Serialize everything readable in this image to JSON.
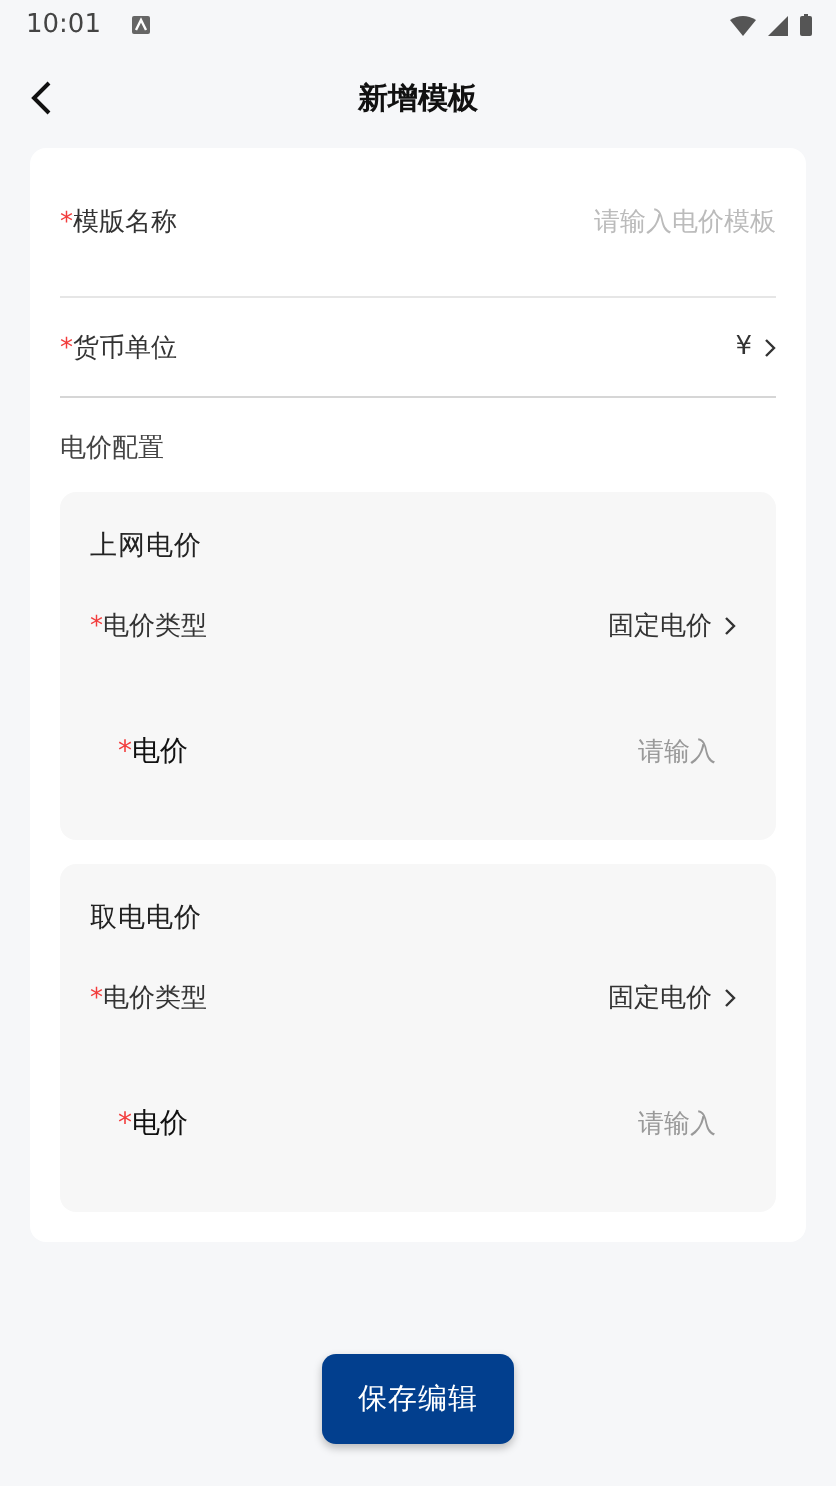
{
  "status_bar": {
    "time": "10:01"
  },
  "header": {
    "title": "新增模板"
  },
  "fields": [
    {
      "required_mark": "*",
      "label": "模版名称",
      "kind": "input",
      "placeholder": "请输入电价模板"
    },
    {
      "required_mark": "*",
      "label": "货币单位",
      "kind": "select",
      "value": "¥"
    }
  ],
  "section": {
    "title": "电价配置"
  },
  "groups": [
    {
      "title": "上网电价",
      "rows": [
        {
          "required_mark": "*",
          "label": "电价类型",
          "kind": "select",
          "value": "固定电价"
        },
        {
          "required_mark": "*",
          "label": "电价",
          "kind": "input",
          "placeholder": "请输入"
        }
      ]
    },
    {
      "title": "取电电价",
      "rows": [
        {
          "required_mark": "*",
          "label": "电价类型",
          "kind": "select",
          "value": "固定电价"
        },
        {
          "required_mark": "*",
          "label": "电价",
          "kind": "input",
          "placeholder": "请输入"
        }
      ]
    }
  ],
  "save_button": {
    "label": "保存编辑"
  }
}
